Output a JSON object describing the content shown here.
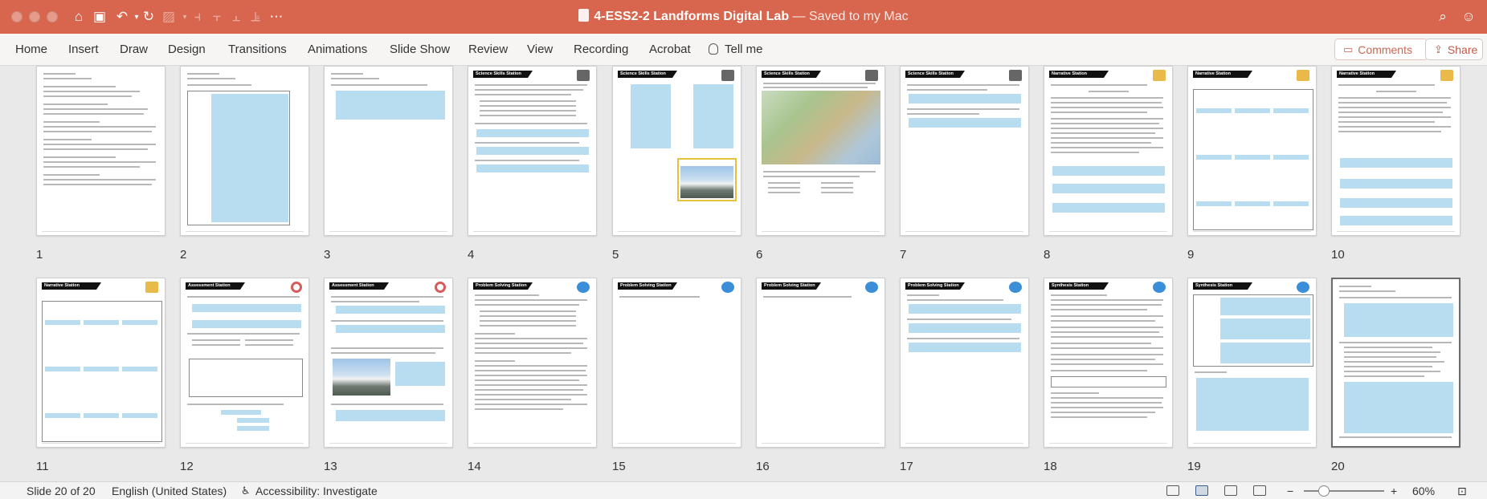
{
  "window": {
    "doc_name": "4-ESS2-2 Landforms Digital Lab",
    "save_status": " — Saved to my Mac"
  },
  "ribbon": {
    "tabs": [
      "Home",
      "Insert",
      "Draw",
      "Design",
      "Transitions",
      "Animations",
      "Slide Show",
      "Review",
      "View",
      "Recording",
      "Acrobat"
    ],
    "tell_me": "Tell me",
    "comments_label": "Comments",
    "share_label": "Share"
  },
  "slides": [
    {
      "number": "1",
      "header": ""
    },
    {
      "number": "2",
      "header": ""
    },
    {
      "number": "3",
      "header": ""
    },
    {
      "number": "4",
      "header": "Science Skills Station"
    },
    {
      "number": "5",
      "header": "Science Skills Station"
    },
    {
      "number": "6",
      "header": "Science Skills Station"
    },
    {
      "number": "7",
      "header": "Science Skills Station"
    },
    {
      "number": "8",
      "header": "Narrative Station"
    },
    {
      "number": "9",
      "header": "Narrative Station"
    },
    {
      "number": "10",
      "header": "Narrative Station"
    },
    {
      "number": "11",
      "header": "Narrative Station"
    },
    {
      "number": "12",
      "header": "Assessment Station"
    },
    {
      "number": "13",
      "header": "Assessment Station"
    },
    {
      "number": "14",
      "header": "Problem Solving Station"
    },
    {
      "number": "15",
      "header": "Problem Solving Station"
    },
    {
      "number": "16",
      "header": "Problem Solving Station"
    },
    {
      "number": "17",
      "header": "Problem Solving Station"
    },
    {
      "number": "18",
      "header": "Synthesis Station"
    },
    {
      "number": "19",
      "header": "Synthesis Station"
    },
    {
      "number": "20",
      "header": ""
    }
  ],
  "statusbar": {
    "slide_count": "Slide 20 of 20",
    "language": "English (United States)",
    "accessibility": "Accessibility: Investigate",
    "zoom_minus": "−",
    "zoom_plus": "+",
    "zoom_level": "60%"
  },
  "colors": {
    "titlebar": "#d8654d",
    "answer_box": "#b8dcf0",
    "accent": "#c05a45"
  }
}
